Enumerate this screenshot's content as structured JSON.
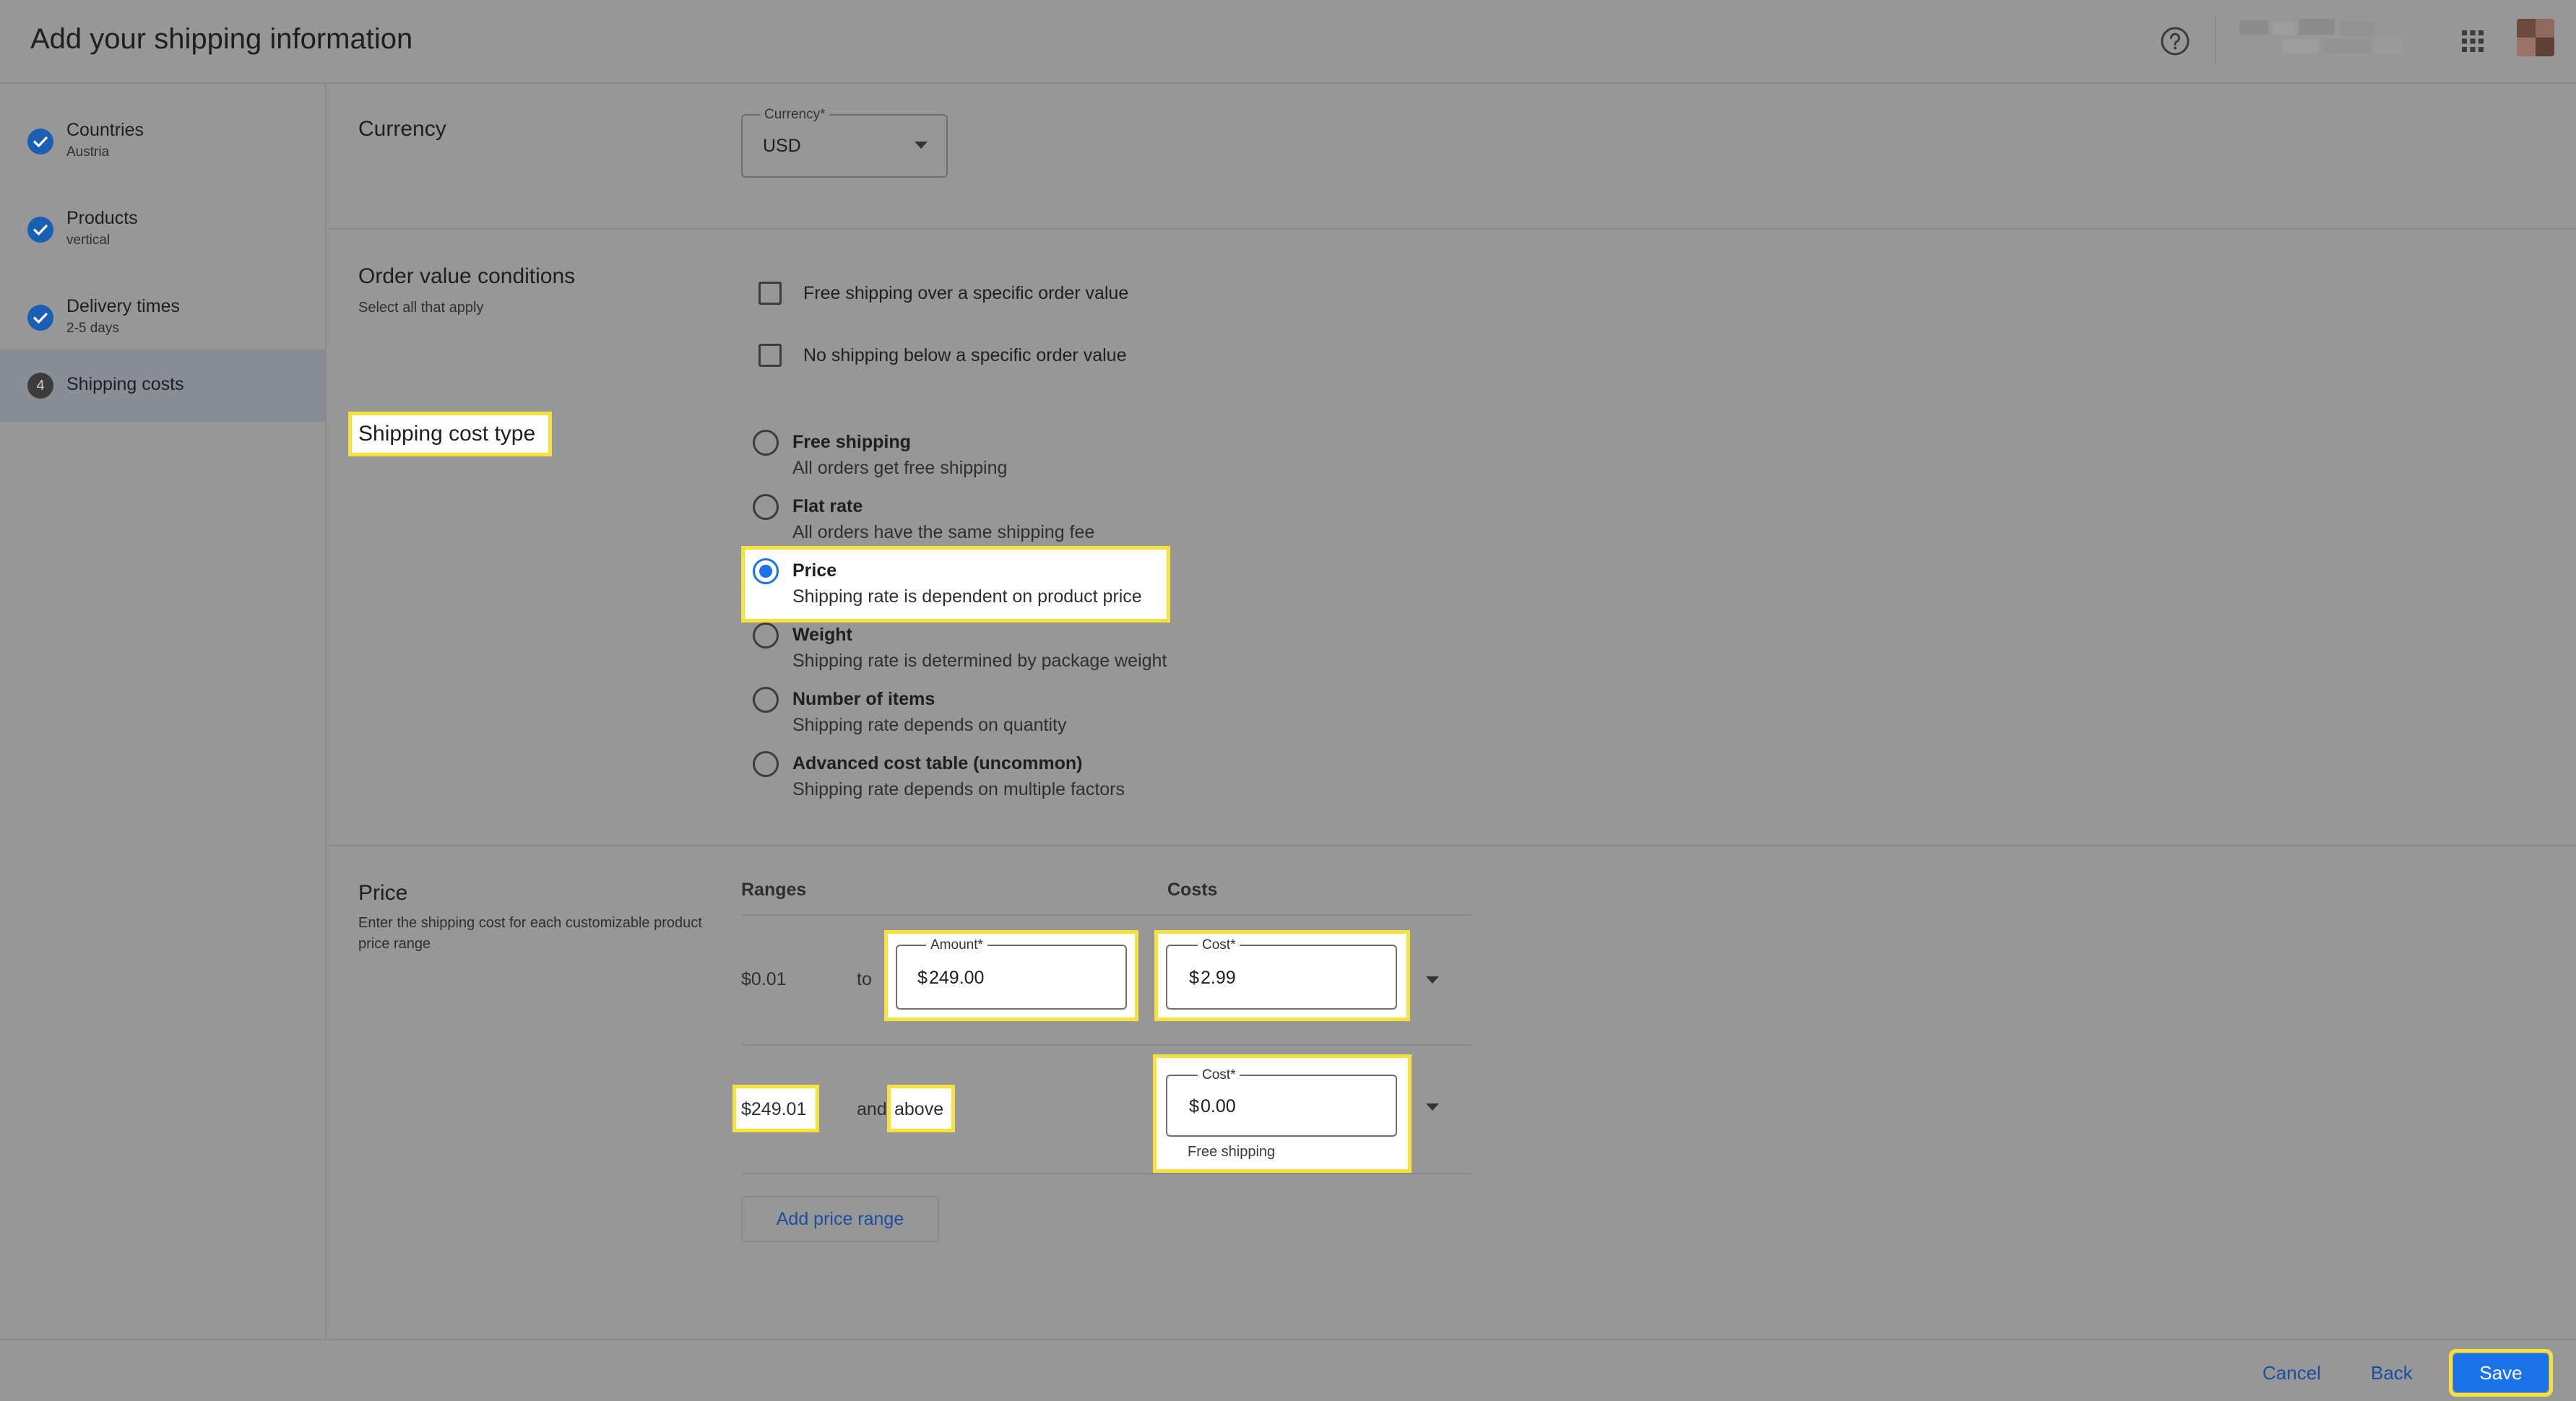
{
  "header": {
    "title": "Add your shipping information"
  },
  "sidebar": {
    "steps": [
      {
        "title": "Countries",
        "subtitle": "Austria"
      },
      {
        "title": "Products",
        "subtitle": "vertical"
      },
      {
        "title": "Delivery times",
        "subtitle": "2-5 days"
      },
      {
        "number": "4",
        "title": "Shipping costs"
      }
    ]
  },
  "currency": {
    "section_title": "Currency",
    "field_label": "Currency*",
    "value": "USD"
  },
  "order_value": {
    "section_title": "Order value conditions",
    "subtitle": "Select all that apply",
    "options": [
      "Free shipping over a specific order value",
      "No shipping below a specific order value"
    ]
  },
  "shipping_cost_type": {
    "section_title": "Shipping cost type",
    "selected": "Price",
    "options": [
      {
        "title": "Free shipping",
        "subtitle": "All orders get free shipping"
      },
      {
        "title": "Flat rate",
        "subtitle": "All orders have the same shipping fee"
      },
      {
        "title": "Price",
        "subtitle": "Shipping rate is dependent on product price"
      },
      {
        "title": "Weight",
        "subtitle": "Shipping rate is determined by package weight"
      },
      {
        "title": "Number of items",
        "subtitle": "Shipping rate depends on quantity"
      },
      {
        "title": "Advanced cost table (uncommon)",
        "subtitle": "Shipping rate depends on multiple factors"
      }
    ]
  },
  "price": {
    "section_title": "Price",
    "subtitle": "Enter the shipping cost for each customizable product price range",
    "col_ranges": "Ranges",
    "col_costs": "Costs",
    "rows": [
      {
        "from": "$0.01",
        "connector": "to",
        "amount_label": "Amount*",
        "amount_prefix": "$",
        "amount_value": "249.00",
        "cost_label": "Cost*",
        "cost_prefix": "$",
        "cost_value": "2.99"
      },
      {
        "from": "$249.01",
        "connector": "and",
        "to_text": "above",
        "cost_label": "Cost*",
        "cost_prefix": "$",
        "cost_value": "0.00",
        "hint": "Free shipping"
      }
    ],
    "add_button": "Add price range"
  },
  "footer": {
    "cancel": "Cancel",
    "back": "Back",
    "save": "Save"
  },
  "colors": {
    "accent": "#1a73e8",
    "highlight": "#f5e23c",
    "link": "#1a4fa0"
  },
  "icons": [
    "help-icon",
    "apps-icon",
    "check-icon",
    "dropdown-caret-icon"
  ]
}
